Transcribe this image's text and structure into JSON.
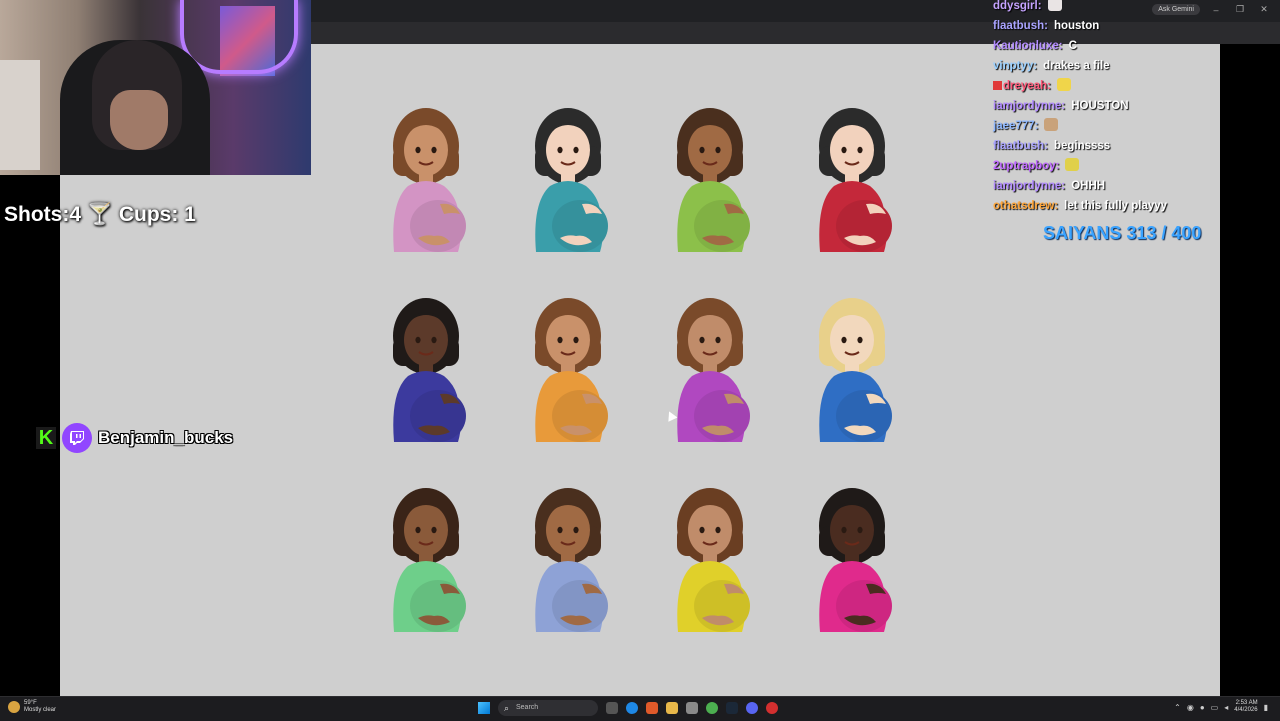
{
  "browser": {
    "ask_gemini": "Ask Gemini"
  },
  "overlay": {
    "shots_cups": "Shots:4 🍸 Cups: 1",
    "social_name": "Benjamin_bucks",
    "saiyans": "SAIYANS 313 / 400"
  },
  "chat": [
    {
      "user": "ddysgirl:",
      "color": "#c5a3ff",
      "text": "",
      "emote": true
    },
    {
      "user": "flaatbush:",
      "color": "#a9a3ff",
      "text": "houston"
    },
    {
      "user": "Kautionluxe:",
      "color": "#b28bff",
      "text": "C"
    },
    {
      "user": "vinptyy:",
      "color": "#9ad0ff",
      "text": "drakes a file"
    },
    {
      "user": "dreyeah:",
      "color": "#ff5a7a",
      "text": "",
      "emote": true,
      "badge": true
    },
    {
      "user": "iamjordynne:",
      "color": "#b28bff",
      "text": "HOUSTON"
    },
    {
      "user": "jaee777:",
      "color": "#8fb8ff",
      "text": "",
      "emote": true
    },
    {
      "user": "flaatbush:",
      "color": "#a9a3ff",
      "text": "beginssss"
    },
    {
      "user": "2uptrapboy:",
      "color": "#c06bff",
      "text": "",
      "emote": true
    },
    {
      "user": "iamjordynne:",
      "color": "#b28bff",
      "text": "OHHH"
    },
    {
      "user": "othatsdrew:",
      "color": "#ffa63a",
      "text": "let this fully playyy"
    }
  ],
  "emojis": [
    {
      "name": "pregnant-woman-pink-icon",
      "skin": "#c9916a",
      "hair": "#7a4a2a",
      "shirt": "#d394c4"
    },
    {
      "name": "pregnant-woman-teal-icon",
      "skin": "#f2d2bd",
      "hair": "#2b2b2b",
      "shirt": "#3a9eaa"
    },
    {
      "name": "pregnant-woman-lime-icon",
      "skin": "#a06a44",
      "hair": "#4a2f1e",
      "shirt": "#8cc04a"
    },
    {
      "name": "pregnant-woman-red-icon",
      "skin": "#f2d2bd",
      "hair": "#2b2b2b",
      "shirt": "#c4283a"
    },
    {
      "name": "pregnant-woman-indigo-icon",
      "skin": "#5c3a2a",
      "hair": "#1f1a18",
      "shirt": "#3c3a9e"
    },
    {
      "name": "pregnant-woman-orange-icon",
      "skin": "#c9916a",
      "hair": "#7a4a2a",
      "shirt": "#e89a3a"
    },
    {
      "name": "pregnant-woman-purple-icon",
      "skin": "#c08c6a",
      "hair": "#7a4a2a",
      "shirt": "#b048c0"
    },
    {
      "name": "pregnant-woman-blue-icon",
      "skin": "#f2d8bd",
      "hair": "#e8d08a",
      "shirt": "#2f6ec4"
    },
    {
      "name": "pregnant-woman-green-icon",
      "skin": "#8a5a3a",
      "hair": "#3a2418",
      "shirt": "#6ecf8a"
    },
    {
      "name": "pregnant-woman-periwinkle-icon",
      "skin": "#a06a44",
      "hair": "#4a2f1e",
      "shirt": "#8ea2d6"
    },
    {
      "name": "pregnant-woman-yellow-icon",
      "skin": "#c08c6a",
      "hair": "#6a3e22",
      "shirt": "#e0d02a"
    },
    {
      "name": "pregnant-woman-magenta-icon",
      "skin": "#4a2c20",
      "hair": "#1f1a18",
      "shirt": "#e02a8c"
    }
  ],
  "taskbar": {
    "weather_temp": "59°F",
    "weather_desc": "Mostly clear",
    "search_label": "Search",
    "clock_time": "2:53 AM",
    "clock_date": "4/4/2026"
  }
}
